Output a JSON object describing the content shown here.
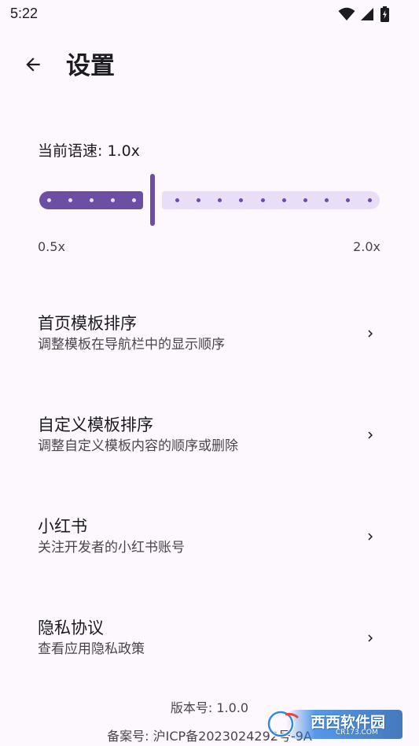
{
  "status_bar": {
    "time": "5:22",
    "icons": [
      "wifi-icon",
      "signal-icon",
      "battery-charging-icon"
    ]
  },
  "app_bar": {
    "back_icon": "arrow-back-icon",
    "title": "设置"
  },
  "speech_rate": {
    "label": "当前语速: 1.0x",
    "min_label": "0.5x",
    "max_label": "2.0x",
    "min": 0.5,
    "max": 2.0,
    "value": 1.0,
    "step": 0.1
  },
  "settings": [
    {
      "title": "首页模板排序",
      "subtitle": "调整模板在导航栏中的显示顺序"
    },
    {
      "title": "自定义模板排序",
      "subtitle": "调整自定义模板内容的顺序或删除"
    },
    {
      "title": "小红书",
      "subtitle": "关注开发者的小红书账号"
    },
    {
      "title": "隐私协议",
      "subtitle": "查看应用隐私政策"
    }
  ],
  "footer": {
    "version": "版本号: 1.0.0",
    "icp": "备案号: 沪ICP备2023024292号-9A"
  },
  "watermark": {
    "text": "西西软件园",
    "sub": "CR173.COM"
  },
  "colors": {
    "background": "#fdf7fe",
    "slider_active": "#6a4fa3",
    "slider_inactive": "#e8def8",
    "text_primary": "#1c1b1f",
    "text_secondary": "#49454f"
  }
}
